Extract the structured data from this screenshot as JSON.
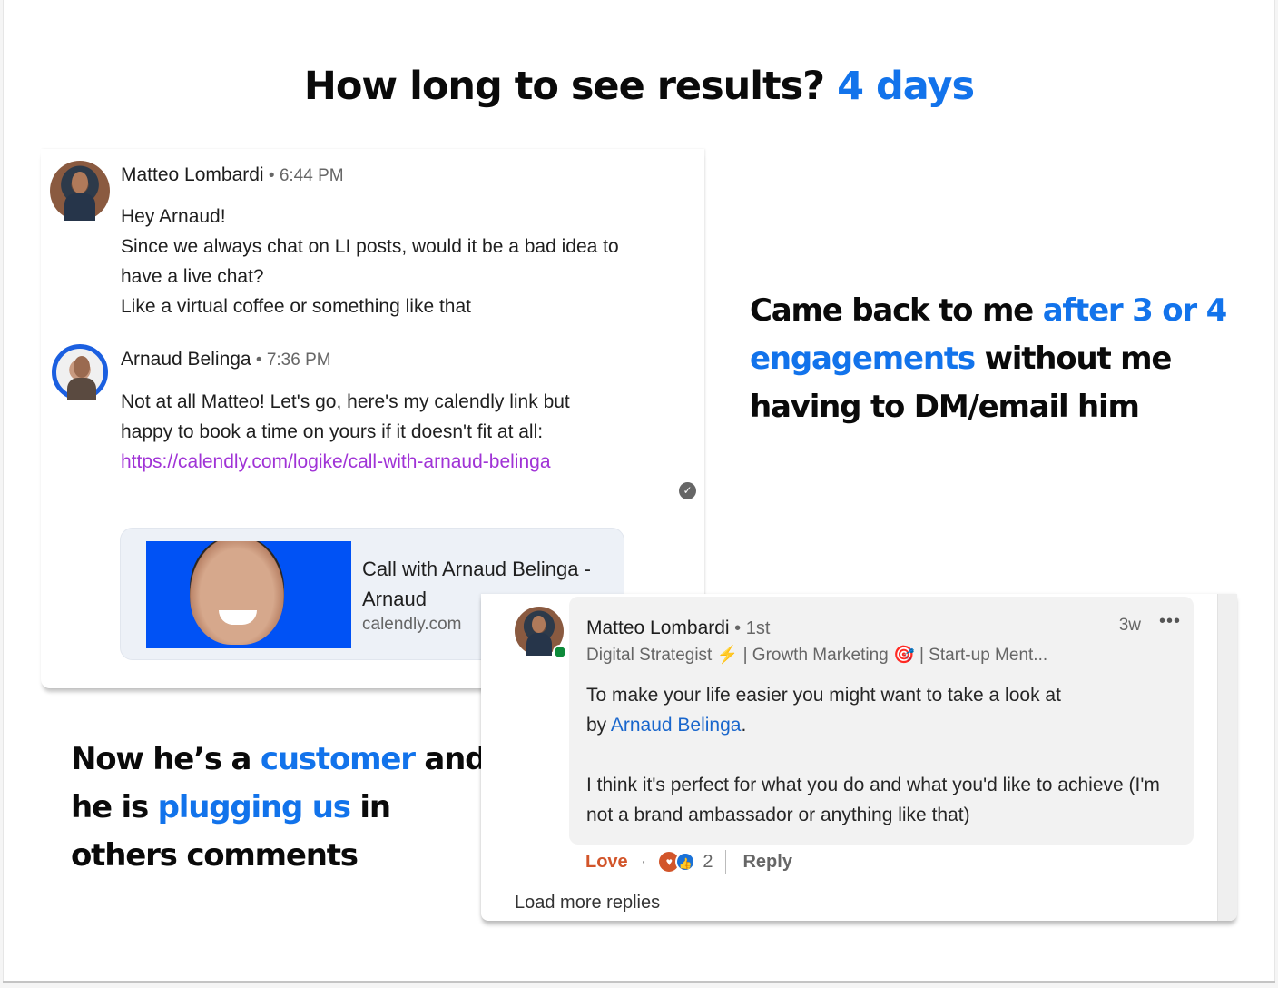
{
  "headline": {
    "prefix": "How long to see results? ",
    "highlight": "4 days"
  },
  "colors": {
    "accent": "#1273eb",
    "link_purple": "#a033d6",
    "love_orange": "#d2552a",
    "mention_blue": "#1966cc",
    "online_green": "#0d8a3a"
  },
  "callout_right": {
    "part1": "Came back to me ",
    "highlight": "after 3 or 4 engagements",
    "part2": " without me having to DM/email him"
  },
  "callout_left": {
    "part1": "Now he’s a ",
    "highlight1": "customer",
    "part2": " and he is ",
    "highlight2": "plugging us",
    "part3": " in others comments"
  },
  "chat": {
    "messages": [
      {
        "sender": "Matteo Lombardi",
        "separator": " • ",
        "time": "6:44 PM",
        "lines": [
          "Hey Arnaud!",
          "Since we always chat on LI posts, would it be a bad idea to have a live chat?",
          "Like a virtual coffee or something like that"
        ]
      },
      {
        "sender": "Arnaud Belinga",
        "separator": " • ",
        "time": "7:36 PM",
        "text": "Not at all Matteo! Let's go, here's my calendly link but happy to book a time on yours if it doesn't fit at all: ",
        "link": "https://calendly.com/logike/call-with-arnaud-belinga"
      }
    ],
    "seen_icon": "check-circle-icon",
    "preview": {
      "title": "Call with Arnaud Belinga - Arnaud",
      "domain": "calendly.com"
    }
  },
  "comment": {
    "author": "Matteo Lombardi",
    "degree": " • 1st",
    "time": "3w",
    "more_icon": "•••",
    "headline": {
      "part1": "Digital Strategist ",
      "emoji1": "⚡",
      "part2": " | Growth Marketing ",
      "emoji2": "🎯",
      "part3": " | Start-up Ment..."
    },
    "text1": "To make your life easier you might want to take a look at",
    "text2_prefix": " by ",
    "mention": "Arnaud Belinga",
    "text2_suffix": ".",
    "text3": "I think it's perfect for what you do and what you'd like to achieve (I'm not a brand ambassador or anything like that)",
    "actions": {
      "love": "Love",
      "dot": "·",
      "reaction_count": "2",
      "reply": "Reply"
    },
    "load_more": "Load more replies"
  }
}
